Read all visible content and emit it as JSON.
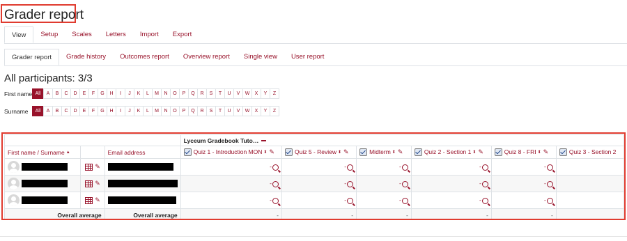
{
  "page": {
    "title": "Grader report",
    "subtitle": "All participants: 3/3"
  },
  "tabs_primary": [
    "View",
    "Setup",
    "Scales",
    "Letters",
    "Import",
    "Export"
  ],
  "tabs_secondary": [
    "Grader report",
    "Grade history",
    "Outcomes report",
    "Overview report",
    "Single view",
    "User report"
  ],
  "filters": {
    "first_name_label": "First name",
    "surname_label": "Surname",
    "all_label": "All",
    "letters": [
      "A",
      "B",
      "C",
      "D",
      "E",
      "F",
      "G",
      "H",
      "I",
      "J",
      "K",
      "L",
      "M",
      "N",
      "O",
      "P",
      "Q",
      "R",
      "S",
      "T",
      "U",
      "V",
      "W",
      "X",
      "Y",
      "Z"
    ]
  },
  "grid": {
    "category_title": "Lyceum Gradebook Tuto…",
    "name_header": "First name / Surname",
    "email_header": "Email address",
    "quizzes": [
      "Quiz 1 - Introduction MON",
      "Quiz 5 - Review",
      "Midterm",
      "Quiz 2 - Section 1",
      "Quiz 8 - FRI",
      "Quiz 3 - Section 2"
    ],
    "grade_placeholder": "-",
    "overall_average_label": "Overall average",
    "overall_average_value": "-",
    "sort_up": "▲",
    "sort_both": "⬍"
  },
  "colors": {
    "accent": "#98122a",
    "highlight_border": "#e03b2f"
  }
}
